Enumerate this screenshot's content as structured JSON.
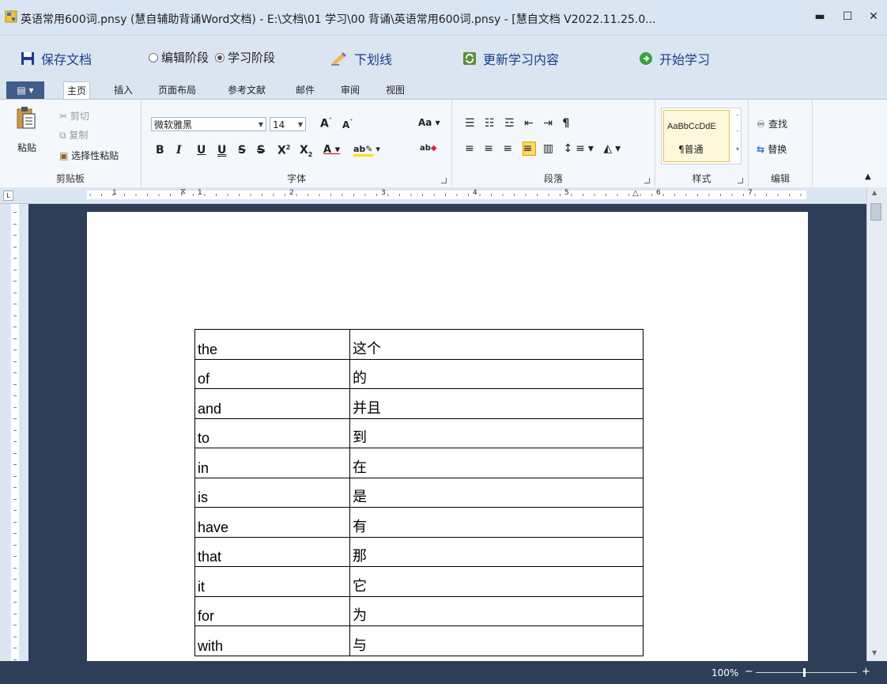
{
  "window": {
    "title": "英语常用600词.pnsy (慧自辅助背诵Word文档) -  E:\\文档\\01 学习\\00 背诵\\英语常用600词.pnsy - [慧自文档 V2022.11.25.0...",
    "minimize": "▬",
    "maximize": "☐",
    "close": "✕"
  },
  "toolbar": {
    "save_label": "保存文档",
    "stage_edit": "编辑阶段",
    "stage_learn": "学习阶段",
    "underline_label": "下划线",
    "update_label": "更新学习内容",
    "start_label": "开始学习"
  },
  "tabs": [
    "主页",
    "插入",
    "页面布局",
    "参考文献",
    "邮件",
    "审阅",
    "视图"
  ],
  "ribbon": {
    "clipboard": {
      "paste": "粘贴",
      "cut": "剪切",
      "copy": "复制",
      "paste_special": "选择性粘贴",
      "label": "剪贴板"
    },
    "font": {
      "name": "微软雅黑",
      "size": "14",
      "label": "字体"
    },
    "paragraph": {
      "label": "段落"
    },
    "styles": {
      "sample": "AaBbCcDdE",
      "normal": "¶普通",
      "label": "样式"
    },
    "editing": {
      "find": "查找",
      "replace": "替换",
      "label": "编辑"
    }
  },
  "ruler": {
    "marks": [
      "1",
      "1",
      "2",
      "3",
      "4",
      "5",
      "6",
      "7"
    ]
  },
  "document": {
    "rows": [
      {
        "en": "the",
        "zh": "这个"
      },
      {
        "en": "of",
        "zh": "的"
      },
      {
        "en": "and",
        "zh": "并且"
      },
      {
        "en": "to",
        "zh": "到"
      },
      {
        "en": "in",
        "zh": "在"
      },
      {
        "en": "is",
        "zh": "是"
      },
      {
        "en": "have",
        "zh": "有"
      },
      {
        "en": "that",
        "zh": "那"
      },
      {
        "en": "it",
        "zh": "它"
      },
      {
        "en": "for",
        "zh": "为"
      },
      {
        "en": "with",
        "zh": "与"
      }
    ]
  },
  "status": {
    "zoom": "100%",
    "zoom_out": "−",
    "zoom_in": "+"
  },
  "colors": {
    "accent": "#1a3d8c",
    "docbg": "#2f3e58",
    "file_tab": "#3f5d8a"
  }
}
